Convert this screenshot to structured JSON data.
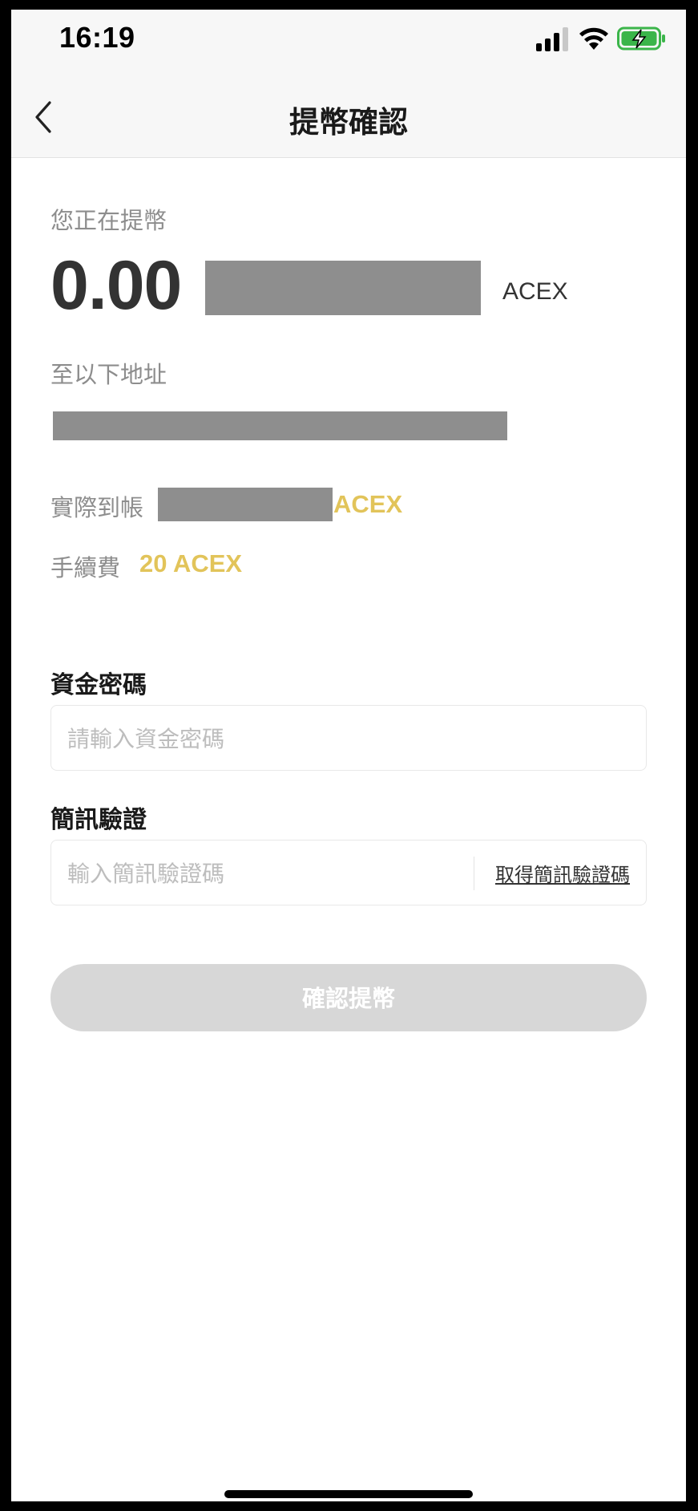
{
  "status_bar": {
    "time": "16:19",
    "icons": [
      "signal-icon",
      "wifi-icon",
      "battery-charging-icon"
    ],
    "battery_color": "#3bb54a"
  },
  "nav": {
    "title": "提幣確認",
    "back_icon": "chevron-left-icon"
  },
  "withdraw": {
    "intro_label": "您正在提幣",
    "amount": "0.00",
    "amount_unit": "ACEX",
    "address_label": "至以下地址",
    "received_label": "實際到帳",
    "received_unit": "ACEX",
    "fee_label": "手續費",
    "fee_value": "20 ACEX",
    "accent_color": "#e2c45a"
  },
  "form": {
    "fund_password": {
      "label": "資金密碼",
      "value": "",
      "placeholder": "請輸入資金密碼"
    },
    "sms": {
      "label": "簡訊驗證",
      "value": "",
      "placeholder": "輸入簡訊驗證碼",
      "get_code_label": "取得簡訊驗證碼"
    },
    "confirm_label": "確認提幣"
  }
}
